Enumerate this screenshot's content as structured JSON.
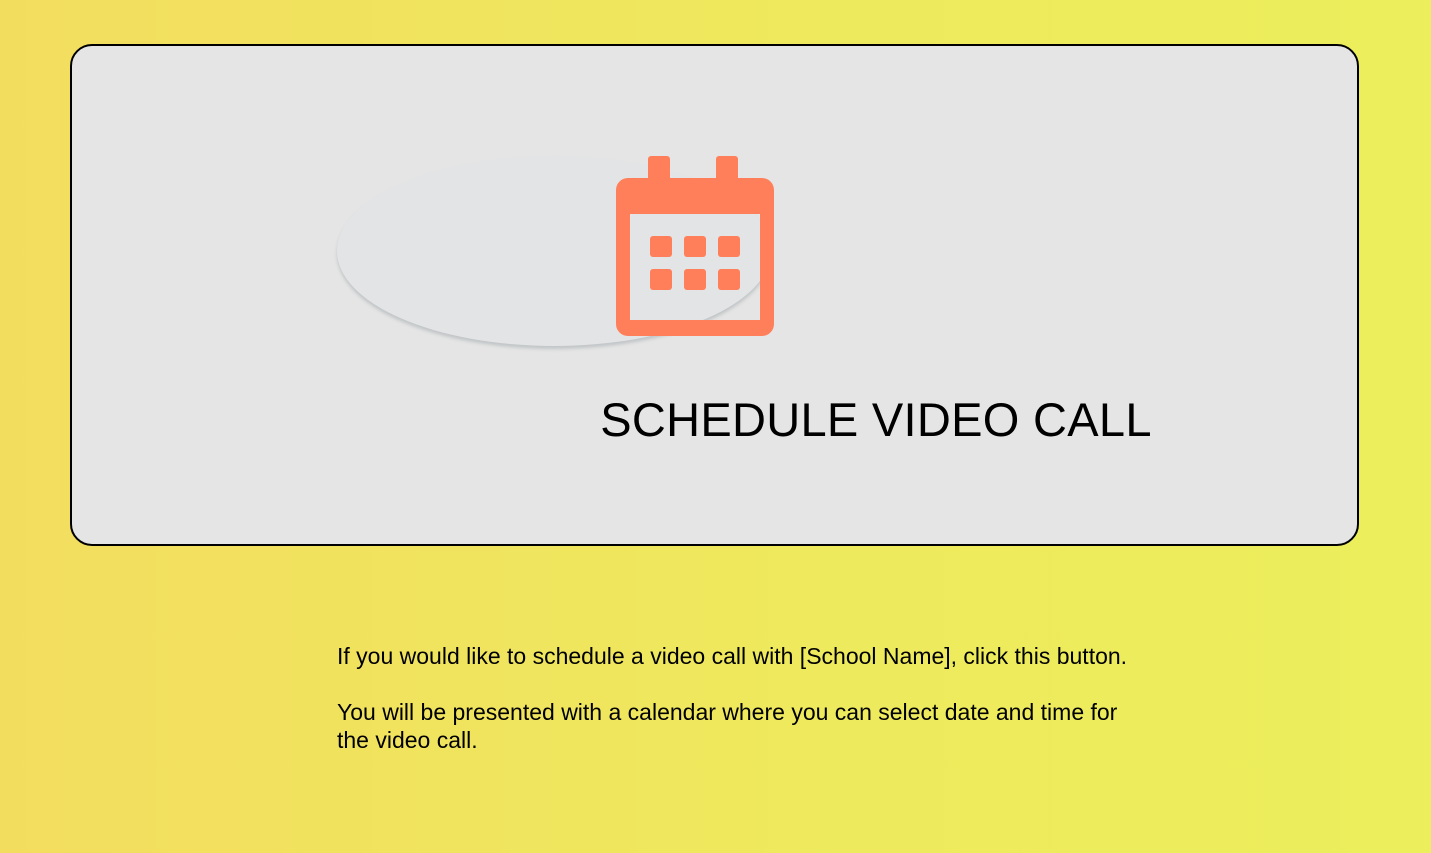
{
  "card": {
    "title": "SCHEDULE VIDEO CALL",
    "icon": "calendar-icon",
    "icon_color": "#ff7f5a",
    "background": "#e5e5e5"
  },
  "description": {
    "line1": "If you would like to schedule a video call with [School Name], click this button.",
    "line2": "You will be presented with a calendar where you can select date and time for the video call."
  },
  "colors": {
    "page_background_start": "#f3dd5f",
    "page_background_end": "#ecee5c",
    "text": "#000000"
  }
}
